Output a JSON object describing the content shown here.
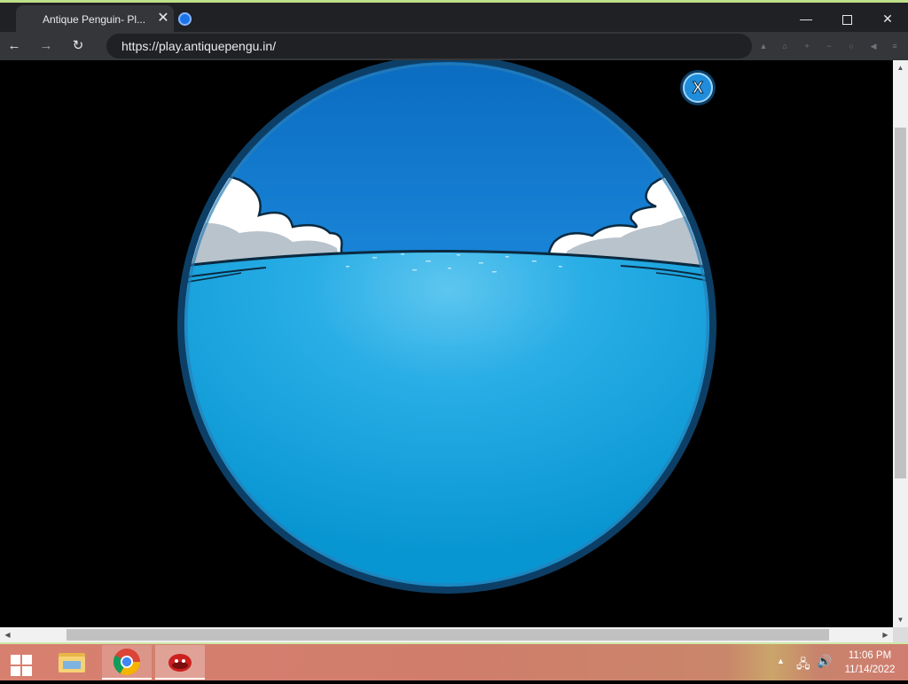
{
  "browser": {
    "tab_title": "Antique Penguin- Pl...",
    "tab_close": "✕",
    "url": "https://play.antiquepengu.in/",
    "nav_back": "←",
    "nav_forward": "→",
    "nav_reload": "↻",
    "window_minimize": "—",
    "window_close": "✕"
  },
  "viewport": {
    "close_button_label": "X",
    "colors": {
      "sky": "#0d77cc",
      "water": "#0a9dd8",
      "rim": "#0d3f66",
      "cloud": "#ffffff",
      "cloud_shadow": "#b9c3cc"
    }
  },
  "scrollbars": {
    "up_arrow": "▲",
    "down_arrow": "▼",
    "left_arrow": "◀",
    "right_arrow": "▶"
  },
  "taskbar": {
    "tray_chevron": "▲",
    "network_icon": "🖧",
    "volume_icon": "🔊",
    "clock_time": "11:06 PM",
    "clock_date": "11/14/2022"
  }
}
